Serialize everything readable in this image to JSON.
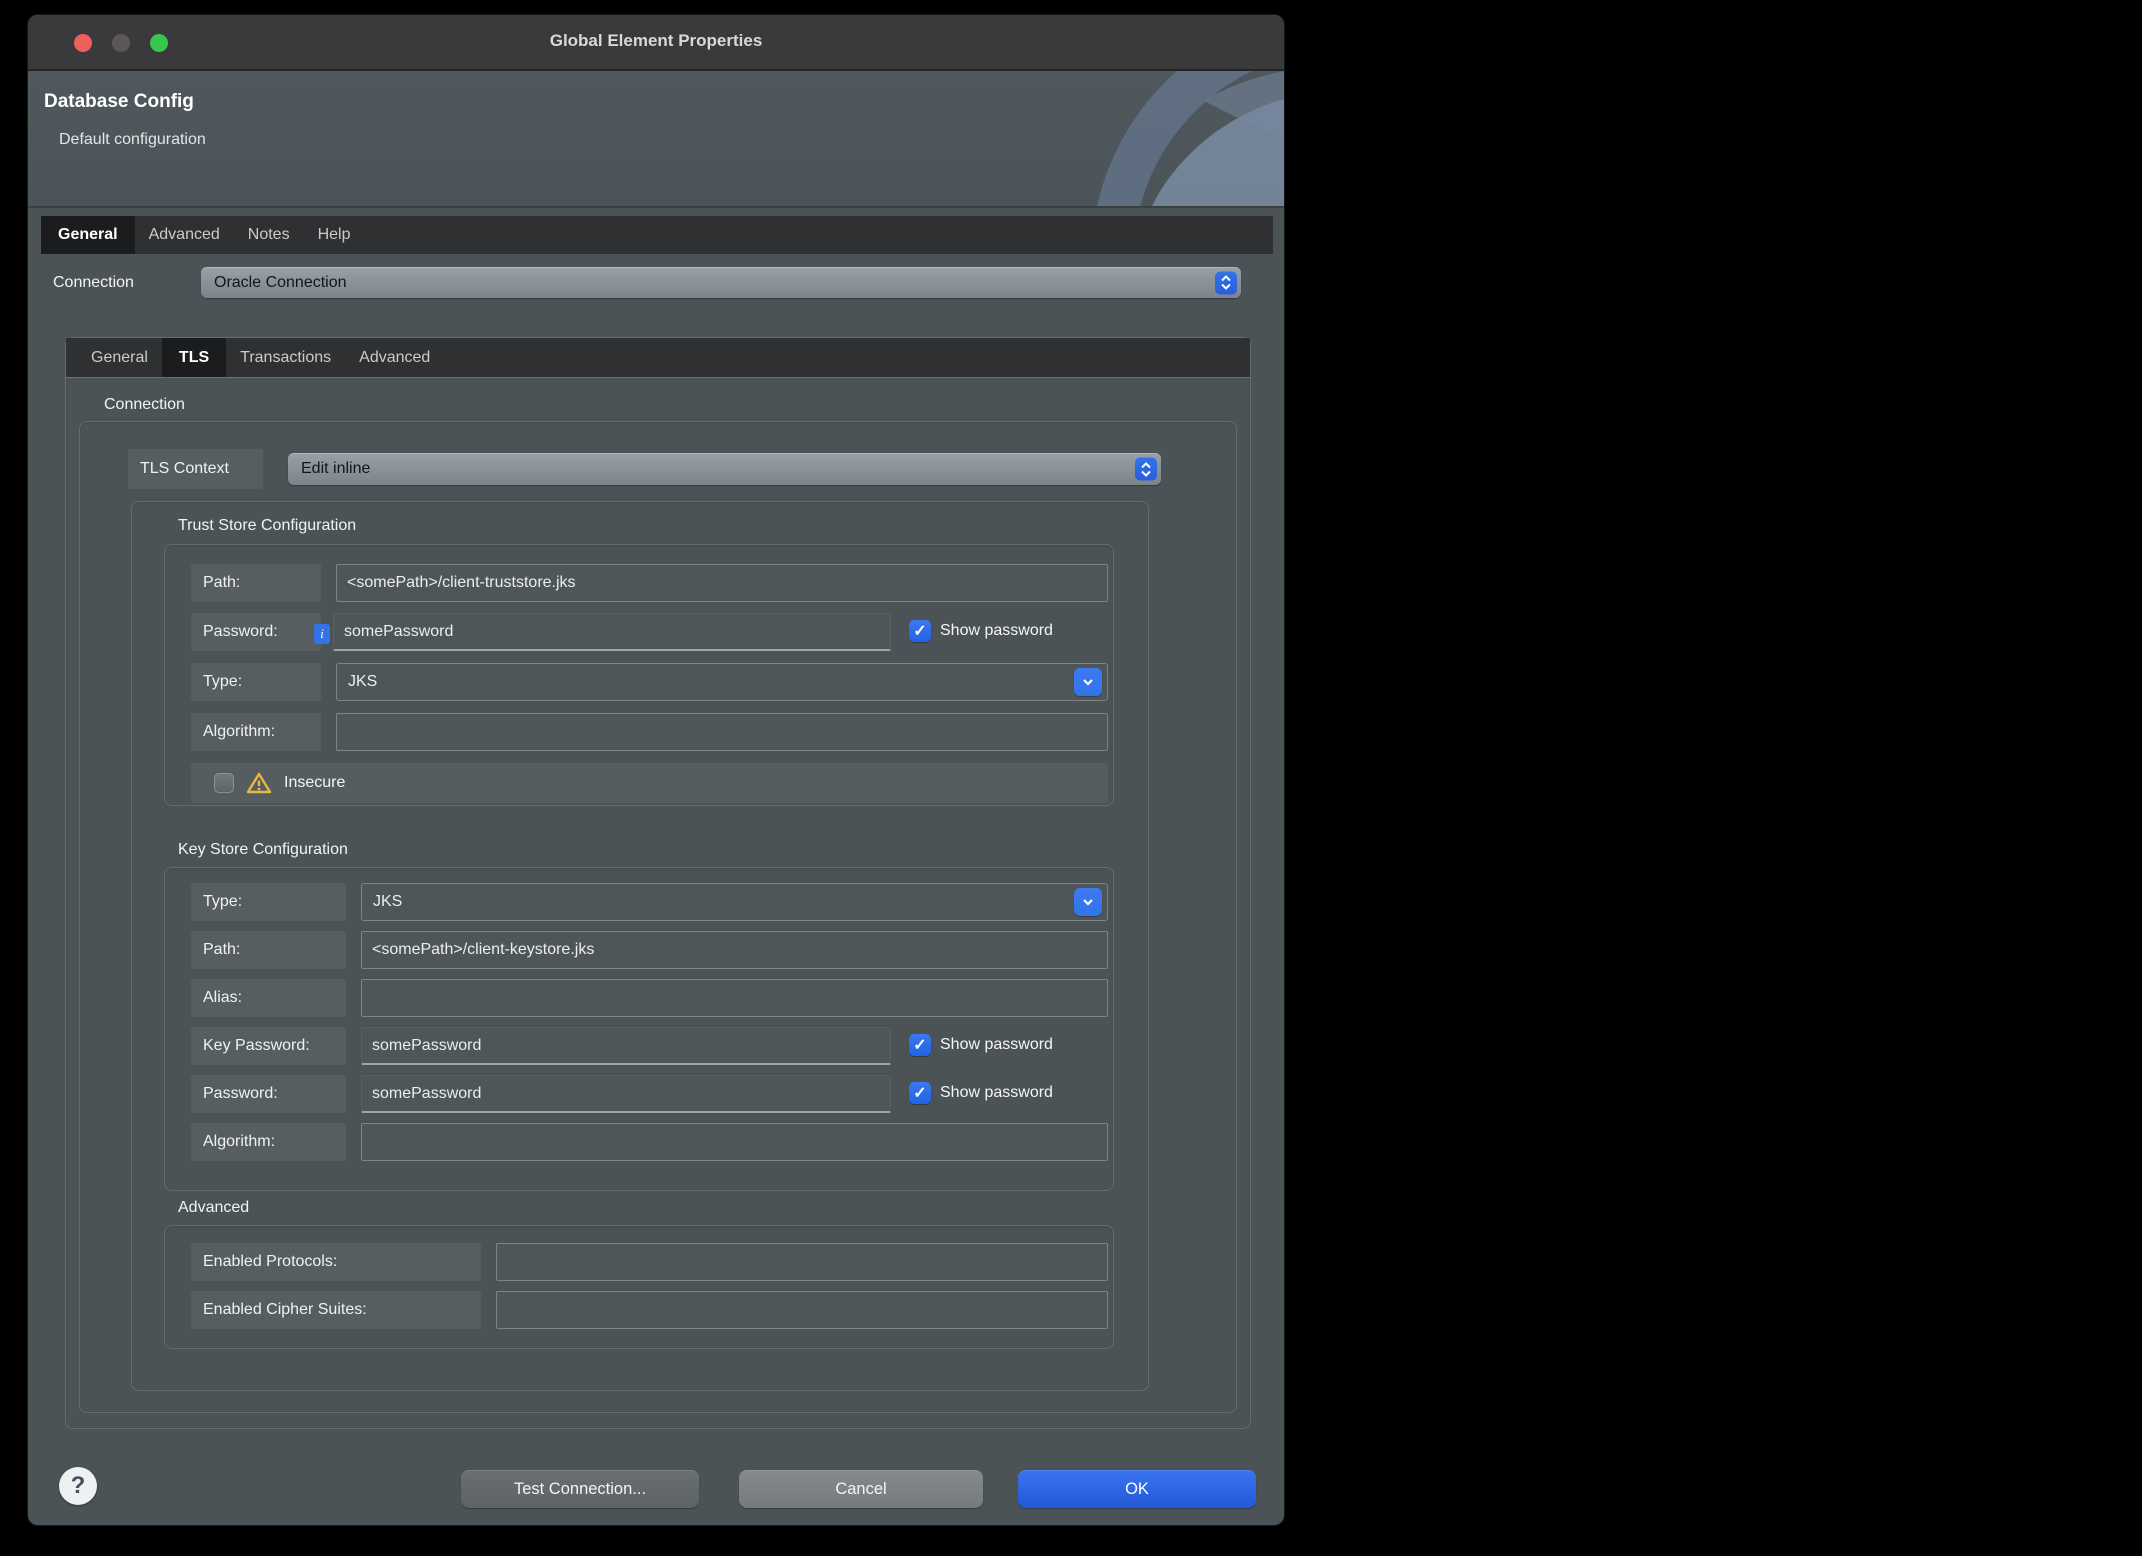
{
  "window": {
    "title": "Global Element Properties"
  },
  "banner": {
    "title": "Database Config",
    "subtitle": "Default configuration"
  },
  "outer_tabs": {
    "items": [
      "General",
      "Advanced",
      "Notes",
      "Help"
    ],
    "selected": "General"
  },
  "connection_field": {
    "label": "Connection",
    "value": "Oracle Connection"
  },
  "inner_tabs": {
    "items": [
      "General",
      "TLS",
      "Transactions",
      "Advanced"
    ],
    "selected": "TLS"
  },
  "connection_group_label": "Connection",
  "tls_context": {
    "label": "TLS Context",
    "value": "Edit inline"
  },
  "trust_store": {
    "title": "Trust Store Configuration",
    "path": {
      "label": "Path:",
      "value": "<somePath>/client-truststore.jks"
    },
    "password": {
      "label": "Password:",
      "value": "somePassword",
      "show_password_label": "Show password",
      "checked": true
    },
    "type": {
      "label": "Type:",
      "value": "JKS"
    },
    "algorithm": {
      "label": "Algorithm:",
      "value": ""
    },
    "insecure": {
      "label": "Insecure",
      "checked": false
    }
  },
  "key_store": {
    "title": "Key Store Configuration",
    "type": {
      "label": "Type:",
      "value": "JKS"
    },
    "path": {
      "label": "Path:",
      "value": "<somePath>/client-keystore.jks"
    },
    "alias": {
      "label": "Alias:",
      "value": ""
    },
    "key_password": {
      "label": "Key Password:",
      "value": "somePassword",
      "show_password_label": "Show password",
      "checked": true
    },
    "password": {
      "label": "Password:",
      "value": "somePassword",
      "show_password_label": "Show password",
      "checked": true
    },
    "algorithm": {
      "label": "Algorithm:",
      "value": ""
    }
  },
  "advanced_section": {
    "title": "Advanced",
    "enabled_protocols": {
      "label": "Enabled Protocols:",
      "value": ""
    },
    "enabled_cipher_suites": {
      "label": "Enabled Cipher Suites:",
      "value": ""
    }
  },
  "footer": {
    "help_label": "?",
    "test_button": "Test Connection...",
    "cancel_button": "Cancel",
    "ok_button": "OK"
  },
  "icons": {
    "check": "✓",
    "info": "i"
  },
  "colors": {
    "accent_blue": "#3174e8",
    "checkbox_blue": "#2463e4",
    "ok_blue": "#2458d8",
    "warning_yellow": "#e9b83d",
    "close_red": "#f0605a",
    "minimize_gray": "#5b5758",
    "zoom_green": "#38c74b"
  }
}
